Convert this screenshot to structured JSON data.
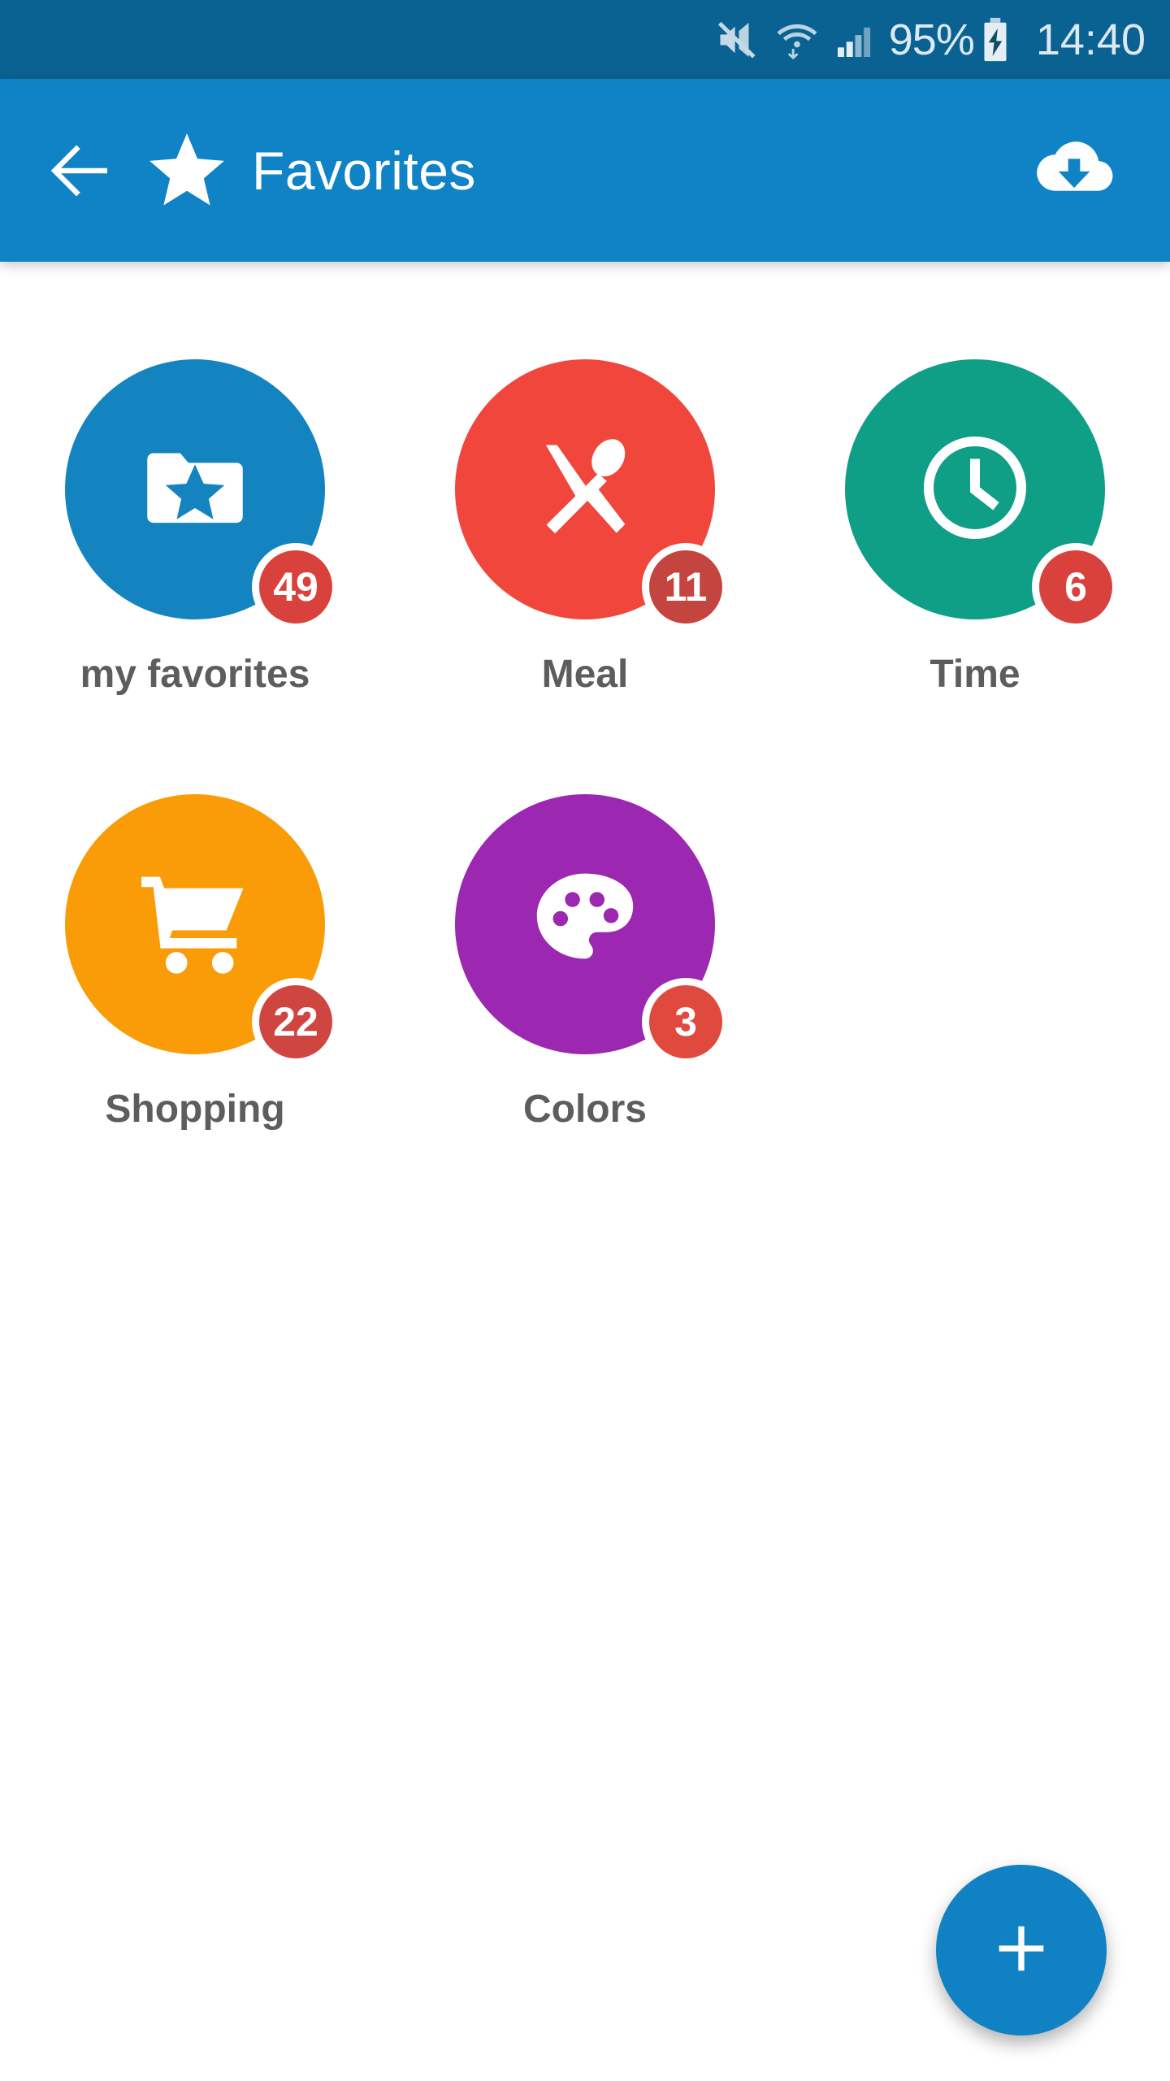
{
  "status_bar": {
    "background": "#0a6292",
    "mute_icon": "mute-speaker-icon",
    "wifi_icon": "wifi-transfer-icon",
    "signal_icon": "cellular-signal-icon",
    "battery_percent": "95%",
    "battery_icon": "battery-charging-icon",
    "clock": "14:40"
  },
  "app_bar": {
    "background": "#0f83c6",
    "back_icon": "arrow-back-icon",
    "leading_icon": "star-icon",
    "title": "Favorites",
    "action_icon": "cloud-download-icon"
  },
  "grid": {
    "items": [
      {
        "label": "my favorites",
        "badge": "49",
        "color": "#1384bf",
        "badge_color": "#d9423c",
        "icon": "folder-star-icon"
      },
      {
        "label": "Meal",
        "badge": "11",
        "color": "#f0463c",
        "badge_color": "#c4453f",
        "icon": "knife-spoon-icon"
      },
      {
        "label": "Time",
        "badge": "6",
        "color": "#0f9e86",
        "badge_color": "#d9423c",
        "icon": "clock-icon"
      },
      {
        "label": "Shopping",
        "badge": "22",
        "color": "#fa9b08",
        "badge_color": "#cf4540",
        "icon": "shopping-cart-icon"
      },
      {
        "label": "Colors",
        "badge": "3",
        "color": "#9c27b0",
        "badge_color": "#e04a3e",
        "icon": "palette-icon"
      }
    ]
  },
  "fab": {
    "icon": "plus-icon",
    "color": "#1082c3"
  }
}
